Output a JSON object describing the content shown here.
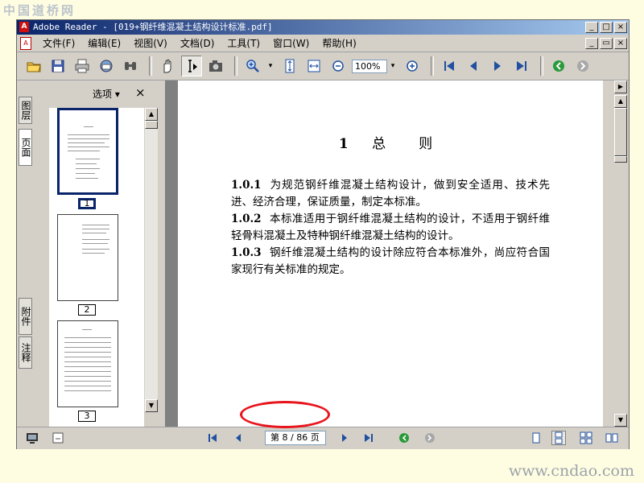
{
  "watermark": {
    "top": "中国道桥网",
    "bottom": "www.cndao.com"
  },
  "window": {
    "title": "Adobe Reader - [019+钢纤维混凝土结构设计标准.pdf]",
    "title_buttons": [
      "_",
      "□",
      "×"
    ],
    "doc_buttons": [
      "_",
      "▭",
      "×"
    ]
  },
  "menu": {
    "items": [
      "文件(F)",
      "编辑(E)",
      "视图(V)",
      "文档(D)",
      "工具(T)",
      "窗口(W)",
      "帮助(H)"
    ]
  },
  "toolbar": {
    "zoom_value": "100%",
    "icons": [
      "open-icon",
      "save-icon",
      "print-icon",
      "email-icon",
      "search-icon",
      "hand-tool-icon",
      "select-text-icon",
      "snapshot-icon",
      "zoom-in-icon",
      "fit-page-icon",
      "fit-width-icon",
      "zoom-out-icon",
      "zoom-in-plus-icon",
      "first-page-icon",
      "previous-page-icon",
      "next-page-icon",
      "last-page-icon",
      "back-icon",
      "forward-icon"
    ]
  },
  "left_tabs": [
    "图层",
    "页面",
    "附件",
    "注释"
  ],
  "nav_panel": {
    "options_label": "选项 ▾",
    "close_label": "×",
    "thumbnails": [
      {
        "label": "1",
        "selected": true
      },
      {
        "label": "2",
        "selected": false
      },
      {
        "label": "3",
        "selected": false
      }
    ]
  },
  "document": {
    "heading_number": "1",
    "heading_text": "总　则",
    "clauses": [
      {
        "number": "1.0.1",
        "text": "为规范钢纤维混凝土结构设计，做到安全适用、技术先进、经济合理，保证质量，制定本标准。"
      },
      {
        "number": "1.0.2",
        "text": "本标准适用于钢纤维混凝土结构的设计，不适用于钢纤维轻骨料混凝土及特种钢纤维混凝土结构的设计。"
      },
      {
        "number": "1.0.3",
        "text": "钢纤维混凝土结构的设计除应符合本标准外，尚应符合国家现行有关标准的规定。"
      }
    ]
  },
  "statusbar": {
    "page_indicator": "第 8 / 86 页",
    "current_page": 8,
    "total_pages": 86
  },
  "colors": {
    "highlight": "#e8141c",
    "titlebar": "#0a246a",
    "selection": "#0a246a"
  }
}
